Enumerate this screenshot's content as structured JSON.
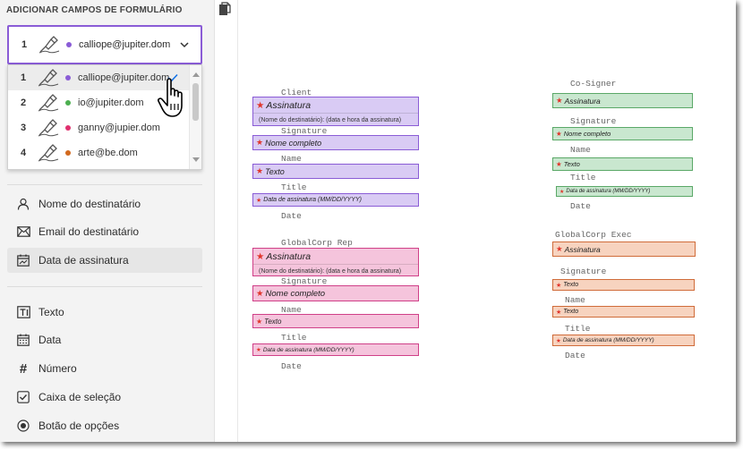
{
  "sidebar": {
    "title": "ADICIONAR CAMPOS DE FORMULÁRIO",
    "selected_recipient": {
      "number": "1",
      "email": "calliope@jupiter.dom",
      "color": "#8a5cd6"
    },
    "recipients": [
      {
        "number": "1",
        "email": "calliope@jupiter.dom",
        "color": "#8a5cd6"
      },
      {
        "number": "2",
        "email": "io@jupiter.dom",
        "color": "#4caf50"
      },
      {
        "number": "3",
        "email": "ganny@jupier.dom",
        "color": "#e0306e"
      },
      {
        "number": "4",
        "email": "arte@be.dom",
        "color": "#d2691e"
      }
    ],
    "recipient_fields": [
      {
        "label": "Nome do destinatário",
        "icon": "person-icon"
      },
      {
        "label": "Email do destinatário",
        "icon": "envelope-icon"
      },
      {
        "label": "Data de assinatura",
        "icon": "calendar-signature-icon"
      }
    ],
    "form_fields": [
      {
        "label": "Texto",
        "icon": "text-field-icon"
      },
      {
        "label": "Data",
        "icon": "calendar-icon"
      },
      {
        "label": "Número",
        "icon": "hash-icon"
      },
      {
        "label": "Caixa de seleção",
        "icon": "checkbox-icon"
      },
      {
        "label": "Botão de opções",
        "icon": "radio-icon"
      }
    ]
  },
  "doc": {
    "client": {
      "heading": "Client",
      "signature_field": "Assinatura",
      "signature_sub": "(Nome do destinatário): (data e hora da assinatura)",
      "signature_label": "Signature",
      "name_field": "Nome completo",
      "name_label": "Name",
      "title_field": "Texto",
      "title_label": "Title",
      "date_field": "Data de assinatura (MM/DD/YYYY)",
      "date_label": "Date"
    },
    "cosigner": {
      "heading": "Co-Signer",
      "signature_field": "Assinatura",
      "signature_label": "Signature",
      "name_field": "Nome completo",
      "name_label": "Name",
      "title_field": "Texto",
      "title_label": "Title",
      "date_field": "Data de assinatura (MM/DD/YYYY)",
      "date_label": "Date"
    },
    "globalcorp_rep": {
      "heading": "GlobalCorp Rep",
      "signature_field": "Assinatura",
      "signature_sub": "(Nome do destinatário): (data e hora da assinatura)",
      "signature_label": "Signature",
      "name_field": "Nome completo",
      "name_label": "Name",
      "title_field": "Texto",
      "title_label": "Title",
      "date_field": "Data de assinatura (MM/DD/YYYY)",
      "date_label": "Date"
    },
    "globalcorp_exec": {
      "heading": "GlobalCorp Exec",
      "signature_field": "Assinatura",
      "signature_label": "Signature",
      "name_field": "Texto",
      "name_label": "Name",
      "title_field": "Texto",
      "title_label": "Title",
      "date_field": "Data de assinatura (MM/DD/YYYY)",
      "date_label": "Date"
    }
  }
}
